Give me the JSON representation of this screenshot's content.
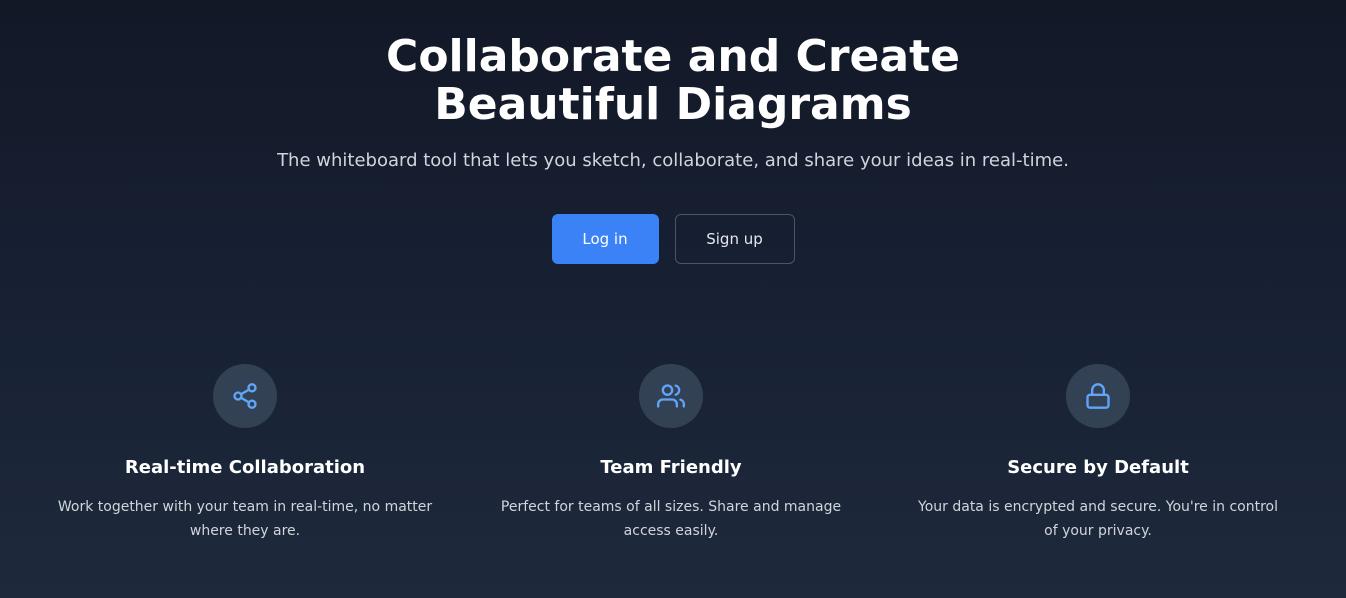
{
  "hero": {
    "title": "Collaborate and Create Beautiful Diagrams",
    "subtitle": "The whiteboard tool that lets you sketch, collaborate, and share your ideas in real-time."
  },
  "actions": {
    "login_label": "Log in",
    "signup_label": "Sign up"
  },
  "features": [
    {
      "icon": "share-icon",
      "title": "Real-time Collaboration",
      "desc_line1": "Work together with your team in real-time, no matter",
      "desc_line2": "where they are."
    },
    {
      "icon": "users-icon",
      "title": "Team Friendly",
      "desc_line1": "Perfect for teams of all sizes. Share and manage",
      "desc_line2": "access easily."
    },
    {
      "icon": "lock-icon",
      "title": "Secure by Default",
      "desc_line1": "Your data is encrypted and secure. You're in control",
      "desc_line2": "of your privacy."
    }
  ],
  "colors": {
    "accent": "#3b82f6",
    "icon_bg": "#334155",
    "background": "#172033"
  }
}
